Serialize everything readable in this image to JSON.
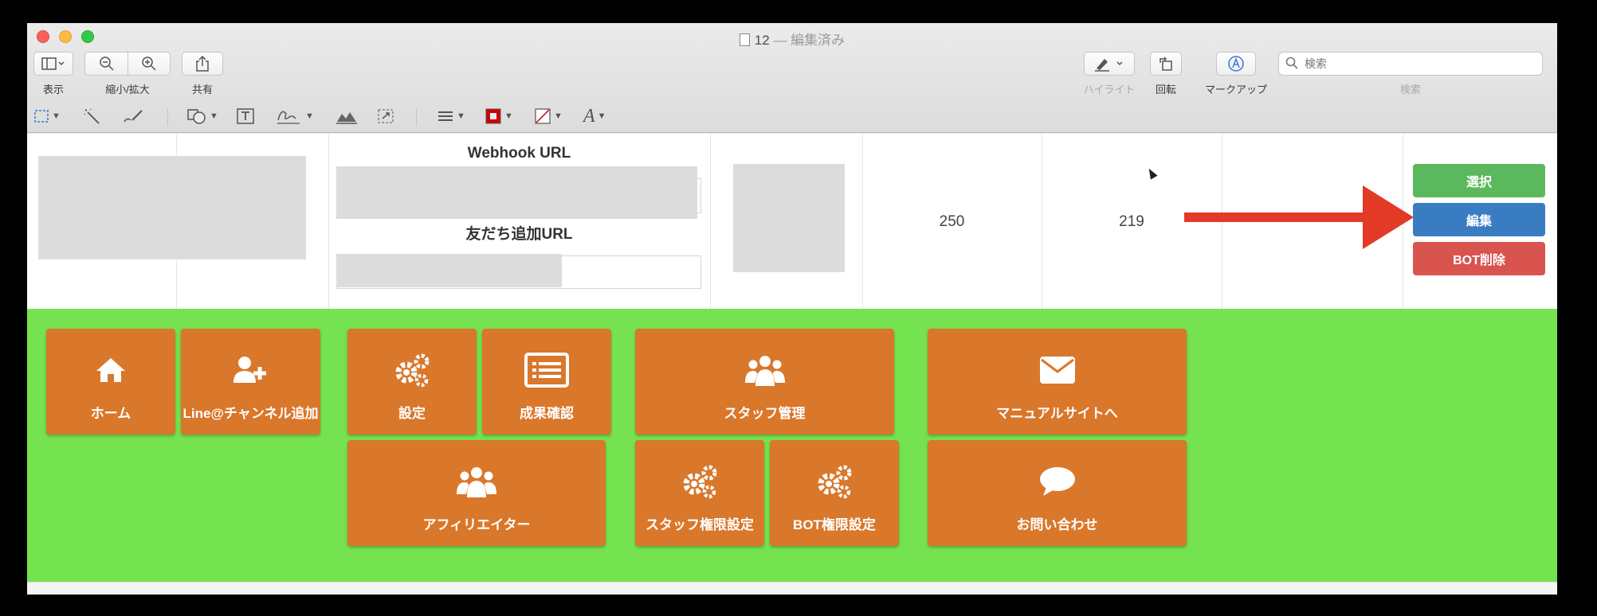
{
  "window": {
    "title": "12",
    "edited": "— 編集済み"
  },
  "toolbar": {
    "view_label": "表示",
    "zoom_label": "縮小/拡大",
    "share_label": "共有",
    "highlight_label": "ハイライト",
    "rotate_label": "回転",
    "markup_label": "マークアップ",
    "search_label": "検索",
    "search_placeholder": "検索"
  },
  "table": {
    "webhook_heading": "Webhook URL",
    "friend_url_heading": "友だち追加URL",
    "value_1": "250",
    "value_2": "219"
  },
  "actions": {
    "select_label": "選択",
    "edit_label": "編集",
    "delete_label": "BOT削除"
  },
  "tiles": [
    {
      "label": "ホーム",
      "icon": "home-icon"
    },
    {
      "label": "Line@チャンネル追加",
      "icon": "add-user-icon"
    },
    {
      "label": "設定",
      "icon": "gears-icon"
    },
    {
      "label": "成果確認",
      "icon": "list-icon"
    },
    {
      "label": "スタッフ管理",
      "icon": "users-icon"
    },
    {
      "label": "マニュアルサイトへ",
      "icon": "envelope-icon"
    },
    {
      "label": "アフィリエイター",
      "icon": "users-icon"
    },
    {
      "label": "スタッフ権限設定",
      "icon": "gears-icon"
    },
    {
      "label": "BOT権限設定",
      "icon": "gears-icon"
    },
    {
      "label": "お問い合わせ",
      "icon": "chat-icon"
    }
  ],
  "colors": {
    "green_bg": "#74e34f",
    "tile": "#d9772b",
    "select": "#5cb85c",
    "edit": "#3a7cc2",
    "delete": "#d9534f",
    "arrow": "#e23a26"
  }
}
